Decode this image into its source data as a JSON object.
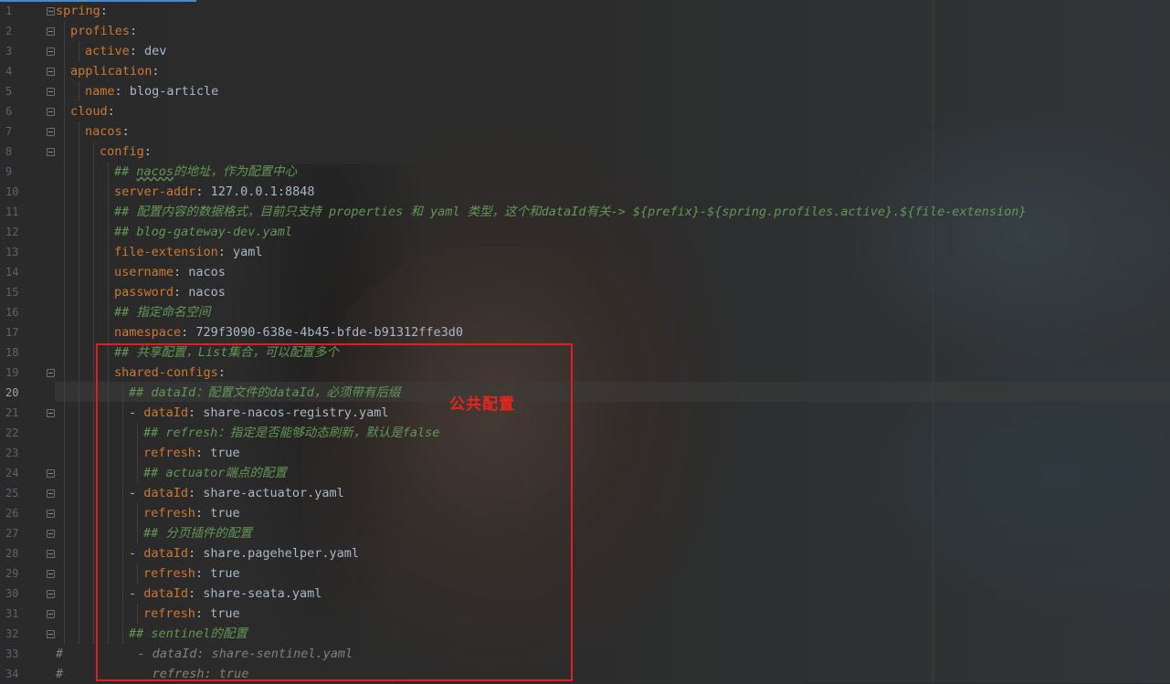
{
  "editor": {
    "current_line": 20,
    "lines": [
      {
        "no": "1",
        "indent": 0,
        "parts": [
          {
            "t": "spring",
            "c": "k"
          },
          {
            "t": ":",
            "c": "p"
          }
        ]
      },
      {
        "no": "2",
        "indent": 1,
        "parts": [
          {
            "t": "profiles",
            "c": "k"
          },
          {
            "t": ":",
            "c": "p"
          }
        ]
      },
      {
        "no": "3",
        "indent": 2,
        "parts": [
          {
            "t": "active",
            "c": "k"
          },
          {
            "t": ": dev",
            "c": "v"
          }
        ]
      },
      {
        "no": "4",
        "indent": 1,
        "parts": [
          {
            "t": "application",
            "c": "k"
          },
          {
            "t": ":",
            "c": "p"
          }
        ]
      },
      {
        "no": "5",
        "indent": 2,
        "parts": [
          {
            "t": "name",
            "c": "k"
          },
          {
            "t": ": blog-article",
            "c": "v"
          }
        ]
      },
      {
        "no": "6",
        "indent": 1,
        "parts": [
          {
            "t": "cloud",
            "c": "k"
          },
          {
            "t": ":",
            "c": "p"
          }
        ]
      },
      {
        "no": "7",
        "indent": 2,
        "parts": [
          {
            "t": "nacos",
            "c": "k"
          },
          {
            "t": ":",
            "c": "p"
          }
        ]
      },
      {
        "no": "8",
        "indent": 3,
        "parts": [
          {
            "t": "config",
            "c": "k"
          },
          {
            "t": ":",
            "c": "p"
          }
        ]
      },
      {
        "no": "9",
        "indent": 4,
        "parts": [
          {
            "t": "## ",
            "c": "c"
          },
          {
            "t": "nacos",
            "c": "c wavy"
          },
          {
            "t": "的地址，作为配置中心",
            "c": "c"
          }
        ]
      },
      {
        "no": "10",
        "indent": 4,
        "parts": [
          {
            "t": "server-addr",
            "c": "k"
          },
          {
            "t": ": 127.0.0.1:8848",
            "c": "v"
          }
        ]
      },
      {
        "no": "11",
        "indent": 4,
        "parts": [
          {
            "t": "## 配置内容的数据格式，目前只支持 properties 和 yaml 类型，这个和dataId有关-> ${prefix}-${spring.profiles.active}.${file-extension}",
            "c": "c"
          }
        ]
      },
      {
        "no": "12",
        "indent": 4,
        "parts": [
          {
            "t": "## blog-gateway-dev.yaml",
            "c": "c"
          }
        ]
      },
      {
        "no": "13",
        "indent": 4,
        "parts": [
          {
            "t": "file-extension",
            "c": "k"
          },
          {
            "t": ": yaml",
            "c": "v"
          }
        ]
      },
      {
        "no": "14",
        "indent": 4,
        "parts": [
          {
            "t": "username",
            "c": "k"
          },
          {
            "t": ": nacos",
            "c": "v"
          }
        ]
      },
      {
        "no": "15",
        "indent": 4,
        "parts": [
          {
            "t": "password",
            "c": "k"
          },
          {
            "t": ": nacos",
            "c": "v"
          }
        ]
      },
      {
        "no": "16",
        "indent": 4,
        "parts": [
          {
            "t": "## 指定命名空间",
            "c": "c"
          }
        ]
      },
      {
        "no": "17",
        "indent": 4,
        "parts": [
          {
            "t": "namespace",
            "c": "k"
          },
          {
            "t": ": 729f3090-638e-4b45-bfde-b91312ffe3d0",
            "c": "v"
          }
        ]
      },
      {
        "no": "18",
        "indent": 4,
        "parts": [
          {
            "t": "## 共享配置，List集合，可以配置多个",
            "c": "c"
          }
        ]
      },
      {
        "no": "19",
        "indent": 4,
        "parts": [
          {
            "t": "shared-configs",
            "c": "k"
          },
          {
            "t": ":",
            "c": "p"
          }
        ]
      },
      {
        "no": "20",
        "indent": 5,
        "parts": [
          {
            "t": "## dataId：配置文件的dataId，必须带有后缀",
            "c": "c"
          }
        ]
      },
      {
        "no": "21",
        "indent": 5,
        "parts": [
          {
            "t": "- ",
            "c": "p"
          },
          {
            "t": "dataId",
            "c": "k"
          },
          {
            "t": ": share-nacos-registry.yaml",
            "c": "v"
          }
        ]
      },
      {
        "no": "22",
        "indent": 6,
        "parts": [
          {
            "t": "## refresh：指定是否能够动态刷新，默认是false",
            "c": "c"
          }
        ]
      },
      {
        "no": "23",
        "indent": 6,
        "parts": [
          {
            "t": "refresh",
            "c": "k"
          },
          {
            "t": ": true",
            "c": "v"
          }
        ]
      },
      {
        "no": "24",
        "indent": 6,
        "parts": [
          {
            "t": "## actuator端点的配置",
            "c": "c"
          }
        ]
      },
      {
        "no": "25",
        "indent": 5,
        "parts": [
          {
            "t": "- ",
            "c": "p"
          },
          {
            "t": "dataId",
            "c": "k"
          },
          {
            "t": ": share-actuator.yaml",
            "c": "v"
          }
        ]
      },
      {
        "no": "26",
        "indent": 6,
        "parts": [
          {
            "t": "refresh",
            "c": "k"
          },
          {
            "t": ": true",
            "c": "v"
          }
        ]
      },
      {
        "no": "27",
        "indent": 6,
        "parts": [
          {
            "t": "## 分页插件的配置",
            "c": "c"
          }
        ]
      },
      {
        "no": "28",
        "indent": 5,
        "parts": [
          {
            "t": "- ",
            "c": "p"
          },
          {
            "t": "dataId",
            "c": "k"
          },
          {
            "t": ": share.pagehelper.yaml",
            "c": "v"
          }
        ]
      },
      {
        "no": "29",
        "indent": 6,
        "parts": [
          {
            "t": "refresh",
            "c": "k"
          },
          {
            "t": ": true",
            "c": "v"
          }
        ]
      },
      {
        "no": "30",
        "indent": 5,
        "parts": [
          {
            "t": "- ",
            "c": "p"
          },
          {
            "t": "dataId",
            "c": "k"
          },
          {
            "t": ": share-seata.yaml",
            "c": "v"
          }
        ]
      },
      {
        "no": "31",
        "indent": 6,
        "parts": [
          {
            "t": "refresh",
            "c": "k"
          },
          {
            "t": ": true",
            "c": "v"
          }
        ]
      },
      {
        "no": "32",
        "indent": 5,
        "parts": [
          {
            "t": "## sentinel的配置",
            "c": "c"
          }
        ]
      },
      {
        "no": "33",
        "indent": 0,
        "parts": [
          {
            "t": "#          - dataId: share-sentinel.yaml",
            "c": "hash"
          }
        ]
      },
      {
        "no": "34",
        "indent": 0,
        "parts": [
          {
            "t": "#            refresh: true",
            "c": "hash"
          }
        ]
      }
    ],
    "fold_lines": [
      1,
      2,
      3,
      4,
      5,
      6,
      7,
      8,
      19,
      21,
      24,
      25,
      26,
      27,
      28,
      29,
      30,
      31,
      32
    ]
  },
  "annotation": {
    "text": "公共配置",
    "color": "#e8251d"
  }
}
